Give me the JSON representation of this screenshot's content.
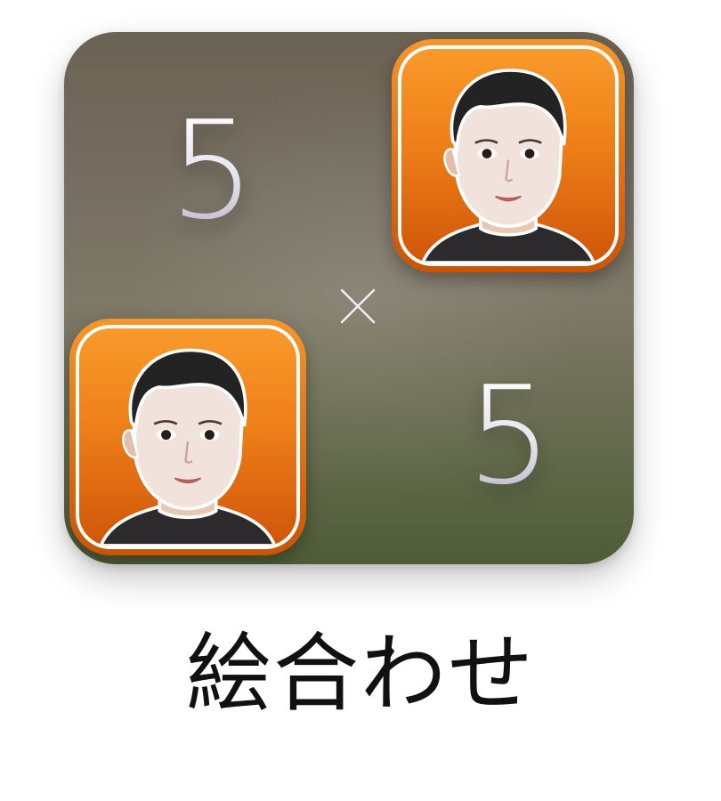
{
  "icon": {
    "label": "絵合わせ",
    "numbers": [
      "5",
      "5"
    ],
    "operator": "×",
    "colors": {
      "tile_top": "#6a6253",
      "tile_bottom": "#4e5c37",
      "accent_orange": "#f5962a",
      "accent_orange_dark": "#c95408",
      "digit": "#e8e6ef"
    },
    "badges": [
      {
        "icon": "face-icon"
      },
      {
        "icon": "face-icon"
      }
    ]
  }
}
